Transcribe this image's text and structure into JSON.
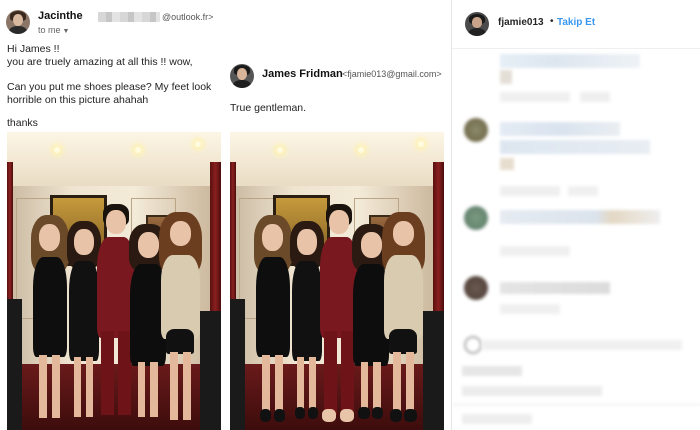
{
  "email1": {
    "sender_name": "Jacinthe",
    "sender_email": "@outlook.fr>",
    "recipient_line": "to me",
    "greeting": "Hi James !!",
    "line1": "you are truely amazing at all this !! wow,",
    "line2": "Can you put me shoes please? My feet look",
    "line3": "horrible on this picture ahahah",
    "signoff": "thanks"
  },
  "email2": {
    "sender_name": "James Fridman",
    "sender_email": "<fjamie013@gmail.com>",
    "body": "True gentleman."
  },
  "instagram": {
    "username": "fjamie013",
    "separator": "•",
    "follow_label": "Takip Et",
    "follow_color": "#3897f0"
  },
  "icons": {
    "recipient_caret": "chevron-down-icon"
  }
}
